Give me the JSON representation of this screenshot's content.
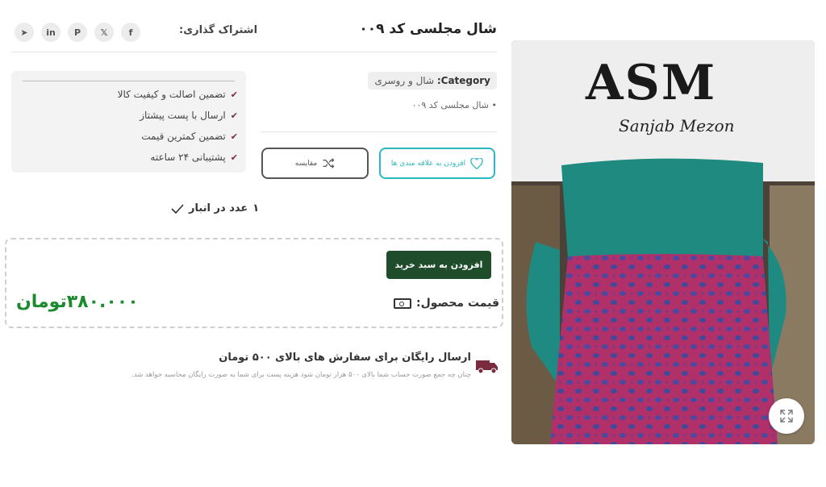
{
  "product": {
    "title": "شال مجلسی کد ۰۰۹",
    "category_label": "Category:",
    "category_value": "شال و روسری",
    "bullet": "شال مجلسی کد ۰۰۹"
  },
  "share": {
    "label": "اشتراک گذاری:",
    "icons": [
      "facebook-icon",
      "x-icon",
      "pinterest-icon",
      "linkedin-icon",
      "telegram-icon"
    ],
    "glyphs": [
      "f",
      "𝕏",
      "P",
      "in",
      "➤"
    ]
  },
  "actions": {
    "wishlist_label": "افزودن به علاقه مندی ها",
    "compare_label": "مقایسه"
  },
  "features": [
    "تضمین اصالت و کیفیت کالا",
    "ارسال با پست پیشتاز",
    "تضمین کمترین قیمت",
    "پشتیبانی ۲۴ ساعته"
  ],
  "stock": {
    "count": "۱",
    "text": "عدد در انبار"
  },
  "cart": {
    "button_label": "افزودن به سبد خرید",
    "price_label": "قیمت محصول:",
    "price_value": "۳۸۰.۰۰۰تومان"
  },
  "shipping": {
    "title": "ارسال رایگان برای سفارش های بالای ۵۰۰ تومان",
    "description": "چنان چه جمع صورت حساب شما بالای ۵۰۰ هزار تومان شود هزینه پست برای شما به صورت رایگان محاسبه خواهد شد."
  },
  "image": {
    "brand_text": "ASM",
    "brand_subtext": "Sanjab Mezon"
  },
  "colors": {
    "accent": "#29b8c1",
    "cart_button": "#1f4d2b",
    "price": "#1c8a2e",
    "check": "#7a2b3e"
  }
}
